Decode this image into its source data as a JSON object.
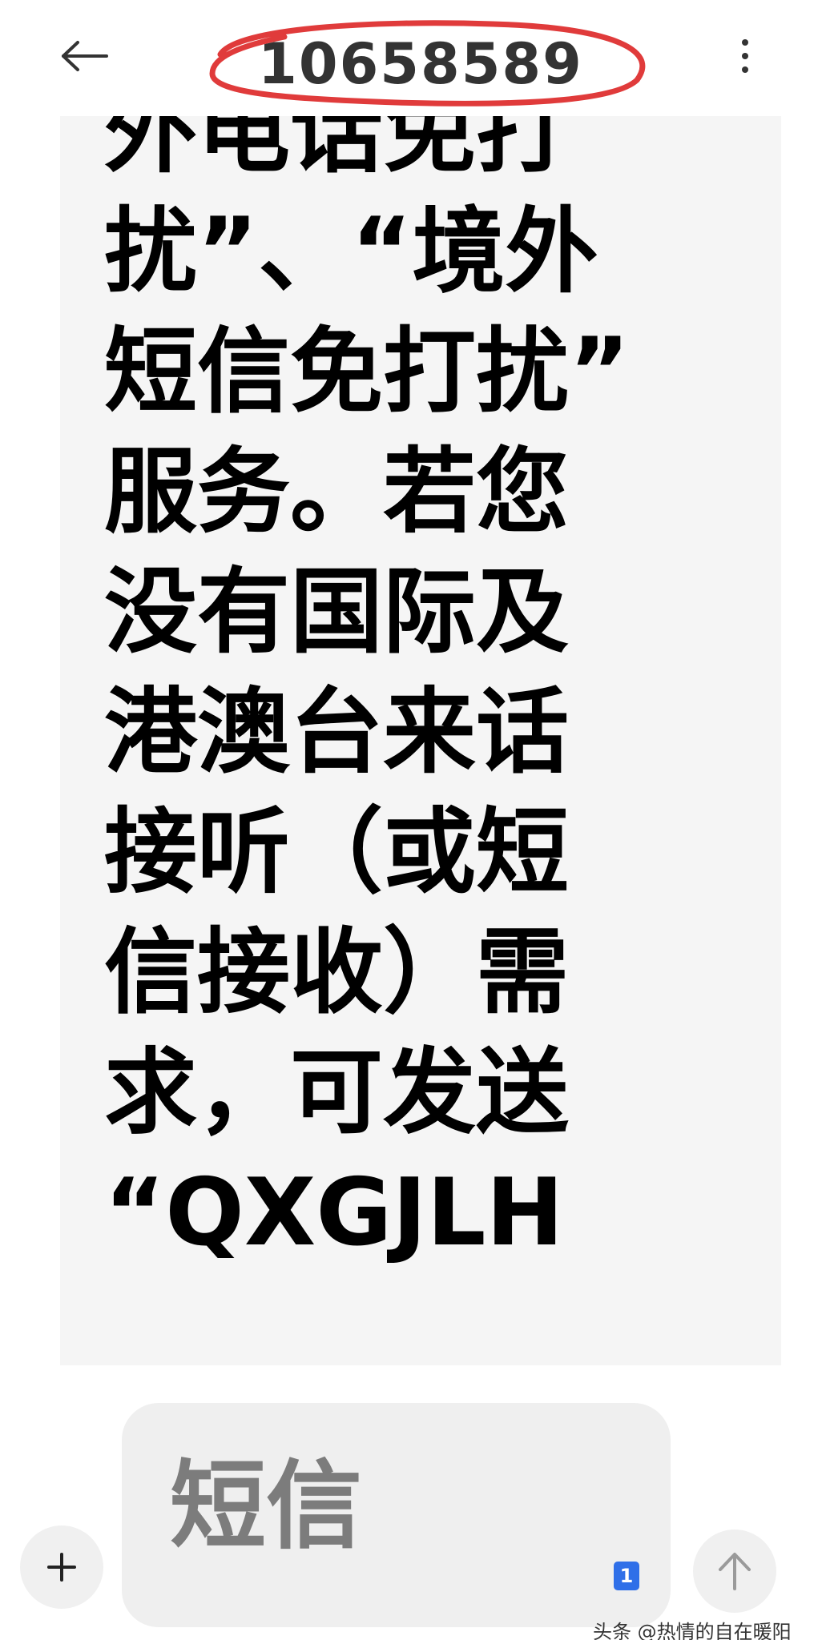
{
  "header": {
    "title": "10658589",
    "back_icon": "back-arrow-icon",
    "more_icon": "more-vertical-icon",
    "annotation_color": "#e03b3b"
  },
  "message": {
    "text": "外电话免打\n扰”、“境外\n短信免打扰”\n服务。若您\n没有国际及\n港澳台来话\n接听（或短\n信接收）需\n求，可发送\n“QXGJLH",
    "bubble_color": "#f5f5f5"
  },
  "composer": {
    "placeholder": "短信",
    "sim_label": "1",
    "sim_color": "#2f6fe8",
    "add_icon": "plus-icon",
    "send_icon": "send-arrow-up-icon"
  },
  "watermark": {
    "text": "头条 @热情的自在暖阳"
  }
}
